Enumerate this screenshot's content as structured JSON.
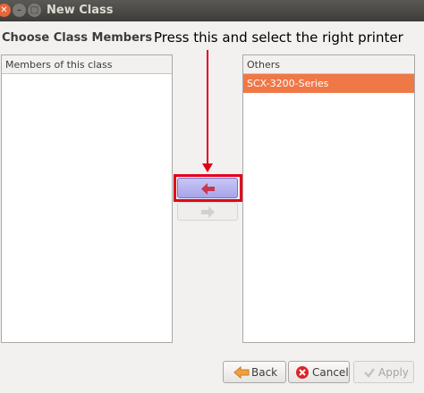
{
  "window": {
    "title": "New Class"
  },
  "section": {
    "title": "Choose Class Members"
  },
  "annotation": {
    "text": "Press this and select the right printer"
  },
  "members_panel": {
    "header": "Members of this class",
    "items": []
  },
  "others_panel": {
    "header": "Others",
    "items": [
      "SCX-3200-Series"
    ],
    "selected_index": 0
  },
  "buttons": {
    "back": "Back",
    "cancel": "Cancel",
    "apply": "Apply"
  },
  "colors": {
    "selection": "#f07746",
    "annotation_red": "#e3001b"
  }
}
